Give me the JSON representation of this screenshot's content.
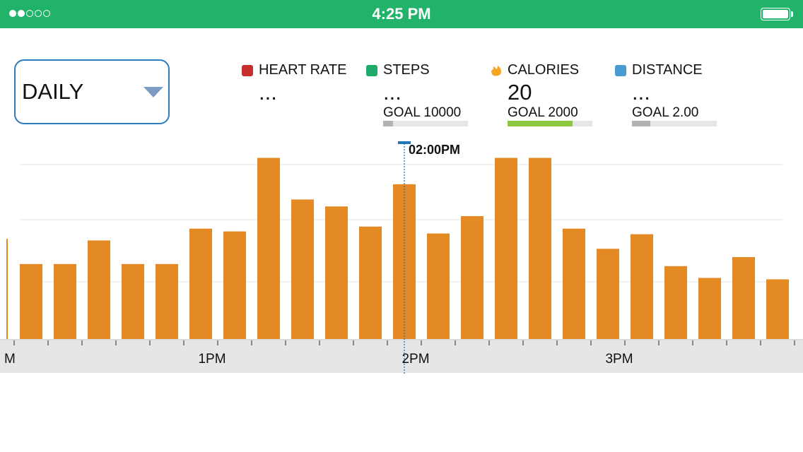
{
  "status_bar": {
    "time": "4:25 PM",
    "signal_bars_filled": 2,
    "signal_bars_total": 5,
    "battery_level": 1.0,
    "background_color": "#22b36a"
  },
  "period_selector": {
    "selected": "DAILY"
  },
  "metrics": {
    "heart_rate": {
      "label": "HEART RATE",
      "value": "...",
      "color": "#c62f2f"
    },
    "steps": {
      "label": "STEPS",
      "value": "...",
      "goal": "GOAL 10000",
      "progress": 0.12,
      "color": "#1fa96b",
      "bar_color": "#b3b3b3"
    },
    "calories": {
      "label": "CALORIES",
      "value": "20",
      "goal": "GOAL 2000",
      "progress": 0.77,
      "color": "#f5a623",
      "bar_color": "#8cc63f",
      "icon": "flame-icon"
    },
    "distance": {
      "label": "DISTANCE",
      "value": "...",
      "goal": "GOAL 2.00",
      "progress": 0.22,
      "color": "#4a9bd1",
      "bar_color": "#b3b3b3"
    }
  },
  "chart_data": {
    "type": "bar",
    "bar_color": "#e38a24",
    "cursor_color": "#1f78b4",
    "cursor_label": "02:00PM",
    "hour_labels": [
      {
        "text": "M",
        "slot": -0.3
      },
      {
        "text": "1PM",
        "slot": 5.5
      },
      {
        "text": "2PM",
        "slot": 11.5
      },
      {
        "text": "3PM",
        "slot": 17.5
      }
    ],
    "cursor_slot": 11.5,
    "values": [
      108,
      108,
      142,
      108,
      108,
      159,
      155,
      261,
      201,
      191,
      162,
      223,
      152,
      177,
      261,
      261,
      159,
      130,
      151,
      105,
      88,
      118,
      86
    ],
    "ylim": [
      0,
      290
    ],
    "grid": true
  }
}
